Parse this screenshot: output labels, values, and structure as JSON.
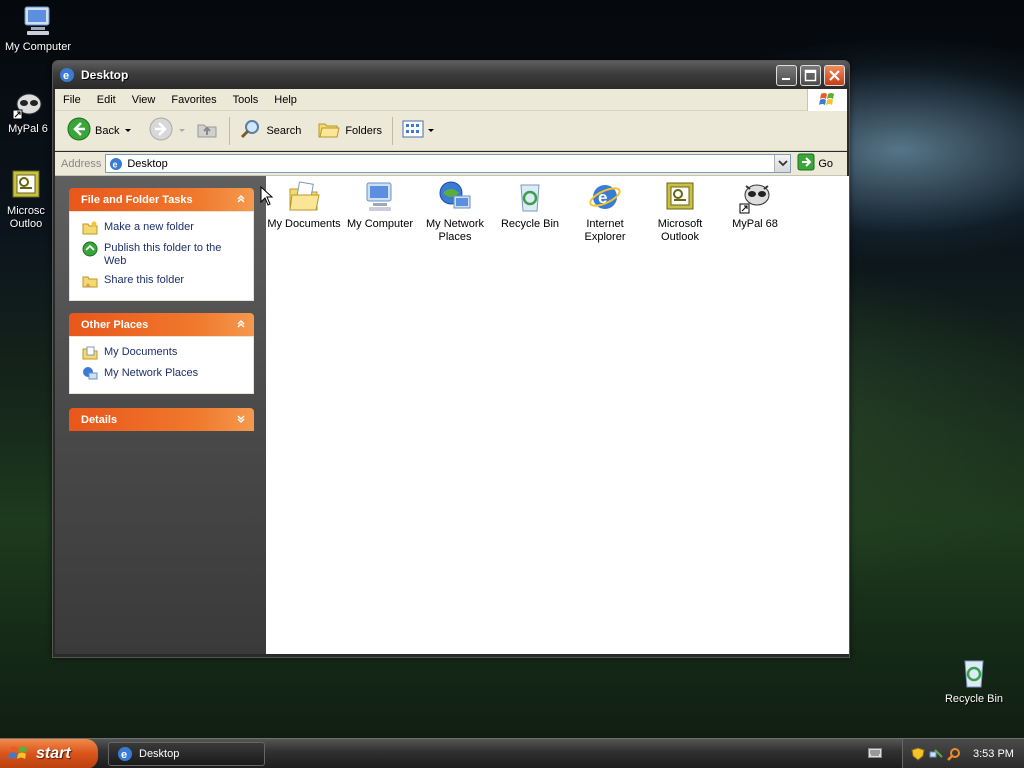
{
  "desktop": {
    "icons": [
      {
        "label": "My Computer"
      },
      {
        "label": "MyPal 6"
      },
      {
        "label": "Microsc Outloo"
      },
      {
        "label": "Recycle Bin"
      }
    ]
  },
  "window": {
    "title": "Desktop",
    "menu": [
      "File",
      "Edit",
      "View",
      "Favorites",
      "Tools",
      "Help"
    ],
    "toolbar": {
      "back": "Back",
      "search": "Search",
      "folders": "Folders"
    },
    "address": {
      "label": "Address",
      "value": "Desktop",
      "go": "Go"
    },
    "panels": {
      "file_tasks": {
        "title": "File and Folder Tasks",
        "items": [
          "Make a new folder",
          "Publish this folder to the Web",
          "Share this folder"
        ]
      },
      "other_places": {
        "title": "Other Places",
        "items": [
          "My Documents",
          "My Network Places"
        ]
      },
      "details": {
        "title": "Details"
      }
    },
    "items": [
      {
        "label": "My Documents"
      },
      {
        "label": "My Computer"
      },
      {
        "label": "My Network Places"
      },
      {
        "label": "Recycle Bin"
      },
      {
        "label": "Internet Explorer"
      },
      {
        "label": "Microsoft Outlook"
      },
      {
        "label": "MyPal 68"
      }
    ]
  },
  "taskbar": {
    "start": "start",
    "task": "Desktop",
    "clock": "3:53 PM"
  },
  "colors": {
    "panel_header": "#e8561b",
    "link_text": "#1c2f6b",
    "start_button": "#d9531b"
  }
}
